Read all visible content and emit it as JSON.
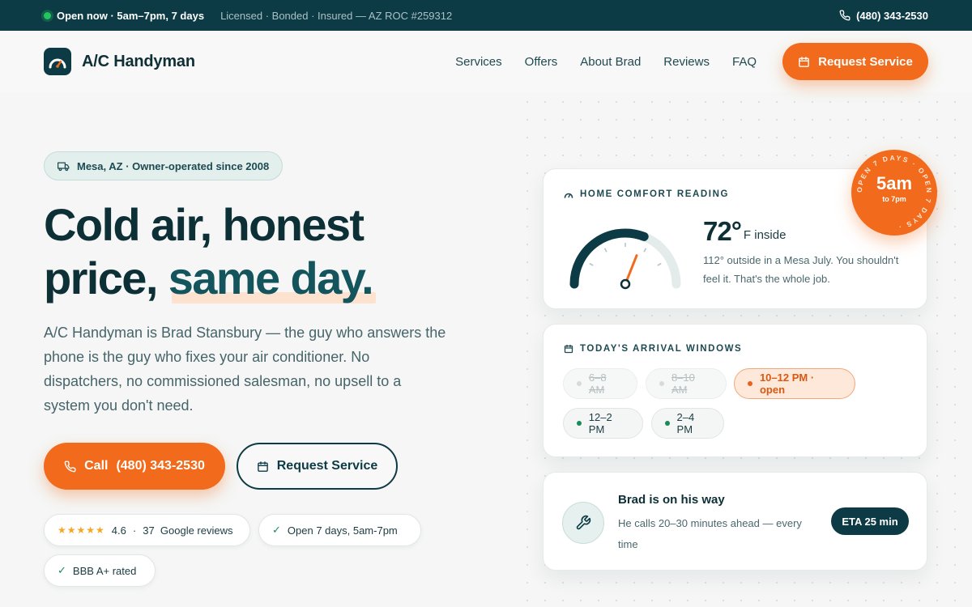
{
  "topbar": {
    "status": "Open now · 5am–7pm, 7 days",
    "license": "Licensed · Bonded · Insured — AZ ROC #259312",
    "phone": "(480) 343-2530",
    "status_color": "#22c55e"
  },
  "nav": {
    "brand": "A/C Handyman",
    "links": [
      "Services",
      "Offers",
      "About Brad",
      "Reviews",
      "FAQ"
    ],
    "cta": "Request Service"
  },
  "hero": {
    "location_pill": "Mesa, AZ · Owner-operated since 2008",
    "headline_line1": "Cold air, honest",
    "headline_line2_prefix": "price, ",
    "headline_line2_accent": "same day.",
    "lead": "A/C Handyman is Brad Stansbury — the guy who answers the phone is the guy who fixes your air conditioner. No dispatchers, no commissioned salesman, no upsell to a system you don't need.",
    "call_prefix": "Call",
    "call_phone": "(480) 343-2530",
    "request_label": "Request Service",
    "chips": {
      "stars": "★★★★★",
      "rating": "4.6",
      "separator": "·",
      "reviews": "37  Google reviews",
      "hours": "Open 7 days, 5am-7pm",
      "bbb": "BBB A+ rated"
    }
  },
  "comfort": {
    "title": "HOME COMFORT READING",
    "temp": "72°",
    "unit": "F inside",
    "desc": "112° outside in a Mesa July. You shouldn't feel it. That's the whole job.",
    "gauge_level": 0.62
  },
  "badge": {
    "big": "5am",
    "small": "to 7pm",
    "ring_text": "OPEN 7 DAYS · OPEN 7 DAYS · "
  },
  "arrival": {
    "title": "TODAY'S ARRIVAL WINDOWS",
    "slots": [
      {
        "label": "6–8 AM",
        "state": "past"
      },
      {
        "label": "8–10 AM",
        "state": "past"
      },
      {
        "label": "10–12 PM · open",
        "state": "selected"
      },
      {
        "label": "12–2 PM",
        "state": "available"
      },
      {
        "label": "2–4 PM",
        "state": "available"
      }
    ]
  },
  "onway": {
    "title": "Brad is on his way",
    "subtitle": "He calls 20–30 minutes ahead — every time",
    "eta": "ETA 25 min"
  },
  "colors": {
    "brand_dark": "#0d3b45",
    "accent_orange": "#f26a1b",
    "available_green": "#1b8a5a"
  }
}
